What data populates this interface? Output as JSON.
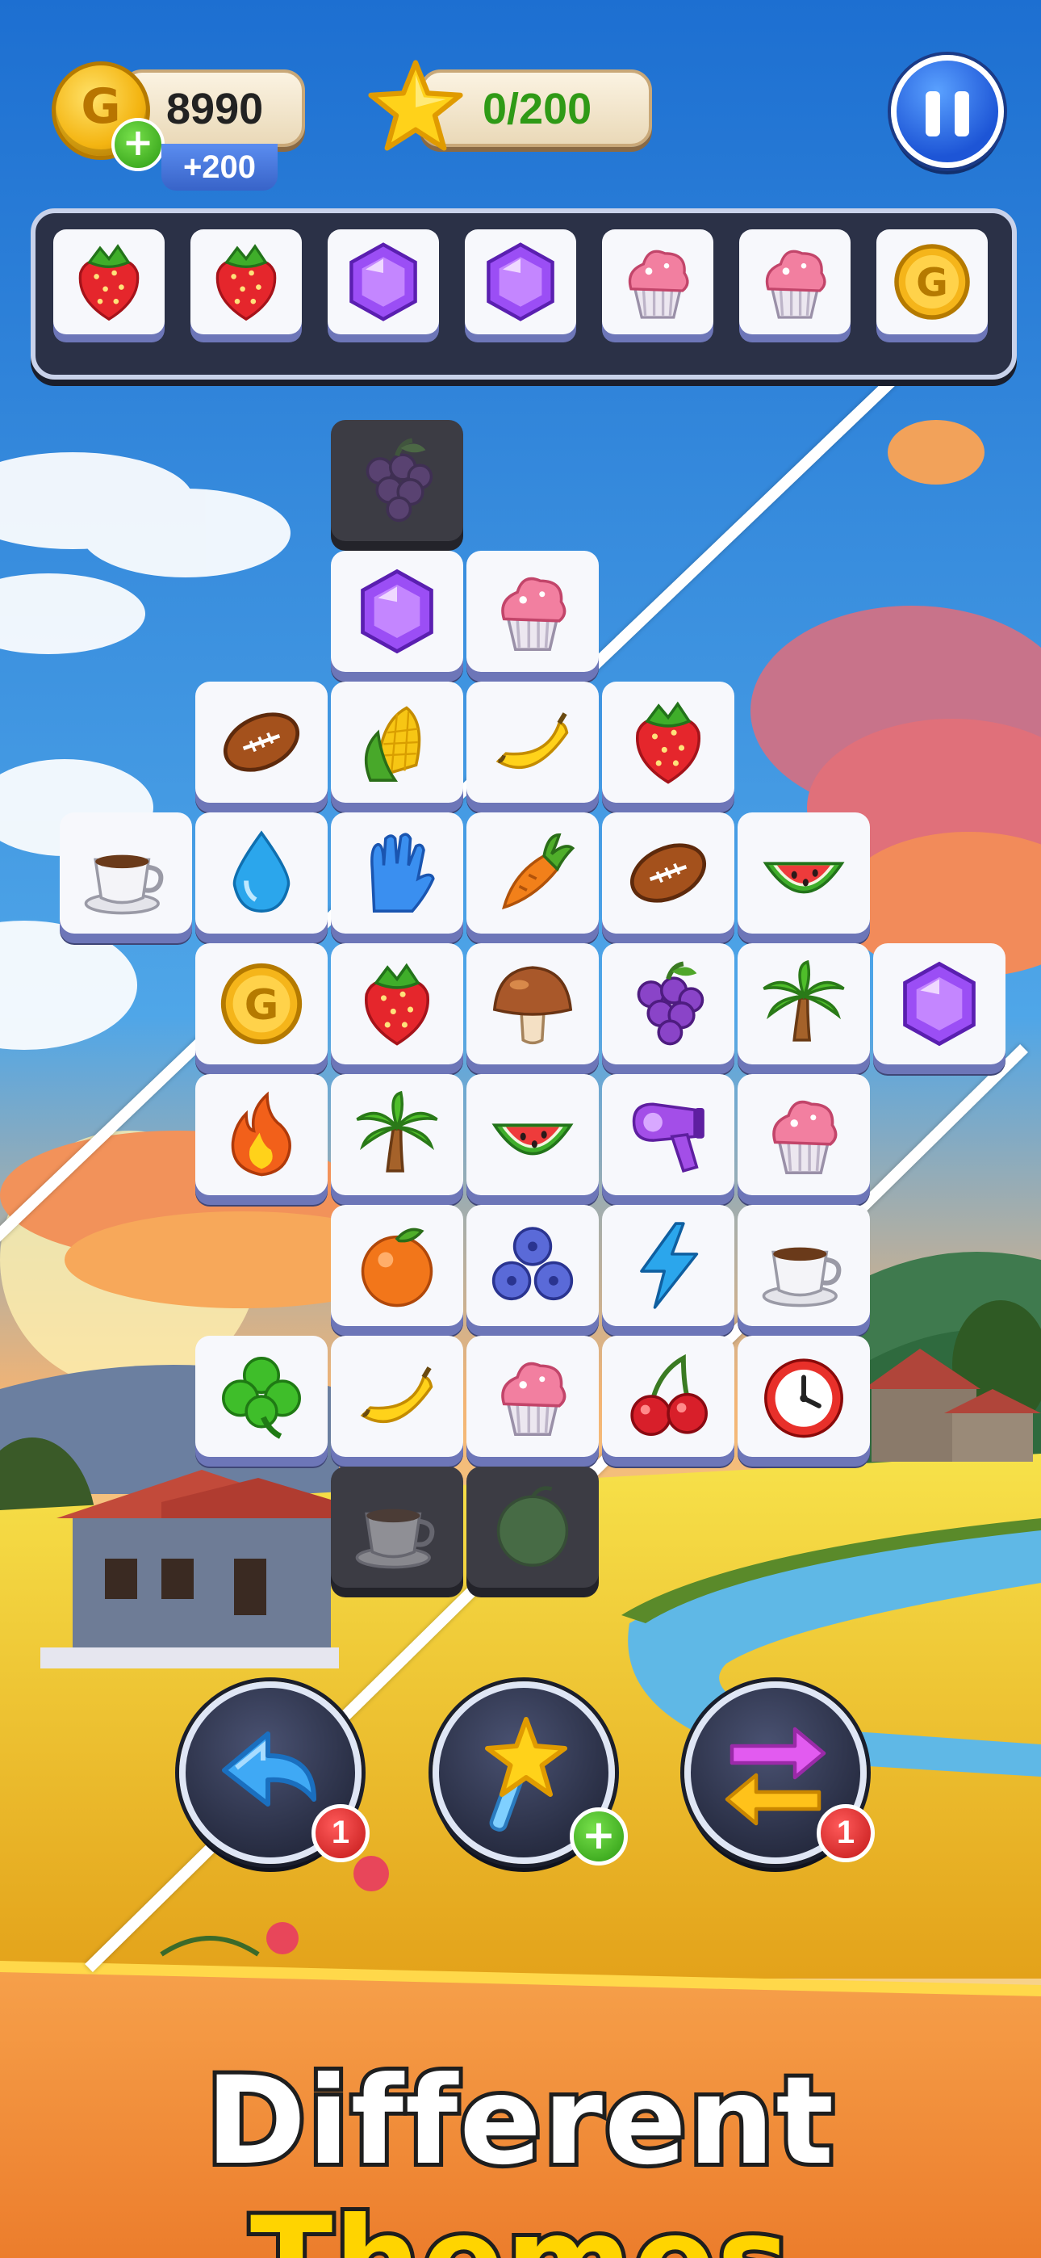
{
  "hud": {
    "coins": "8990",
    "coin_symbol": "G",
    "coin_bonus": "+200",
    "add_symbol": "+",
    "progress": "0/200",
    "progress_collected": 0,
    "progress_goal": 200
  },
  "tray": {
    "slots": [
      "strawberry",
      "strawberry",
      "purple-gem",
      "purple-gem",
      "cupcake",
      "cupcake",
      "gold-coin"
    ]
  },
  "board": {
    "rows": [
      [
        "grape"
      ],
      [
        "purple-gem",
        "cupcake"
      ],
      [
        "football",
        "corn",
        "banana",
        "strawberry"
      ],
      [
        "coffee-cup",
        "water-drop",
        "glove",
        "carrot",
        "football",
        "watermelon"
      ],
      [
        "gold-coin",
        "strawberry",
        "mushroom",
        "grape",
        "palm-tree",
        "purple-gem"
      ],
      [
        "fire",
        "palm-tree",
        "watermelon",
        "hair-dryer",
        "cupcake"
      ],
      [
        "orange",
        "blueberries",
        "lightning",
        "coffee-cup"
      ],
      [
        "clover",
        "banana",
        "cupcake",
        "cherries",
        "clock"
      ],
      [
        "coffee-cup",
        "lime"
      ]
    ]
  },
  "boosters": {
    "undo": {
      "icon": "undo-arrow-icon",
      "count": "1"
    },
    "magic": {
      "icon": "magic-wand-icon",
      "add": "+"
    },
    "shuffle": {
      "icon": "shuffle-icon",
      "count": "1"
    }
  },
  "banner": {
    "word1": "Different",
    "word2": "Themes"
  },
  "colors": {
    "sky": "#2f7fd8",
    "banner": "#f2893a",
    "tile_edge": "#6d76b8",
    "accent_yellow": "#ffd400"
  }
}
